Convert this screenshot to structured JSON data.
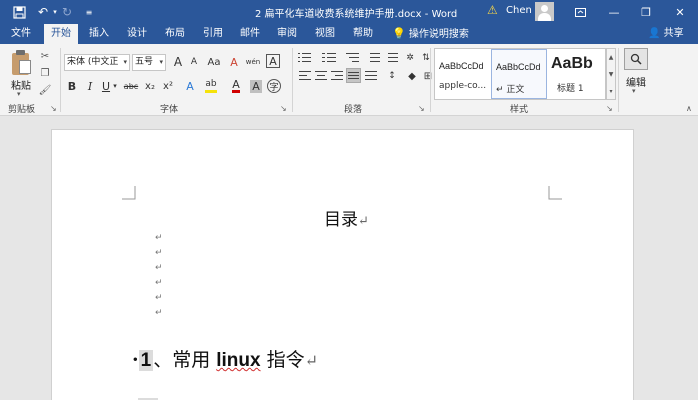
{
  "titlebar": {
    "title": "2 扁平化车道收费系统维护手册.docx  -  Word",
    "user": "Chen",
    "minimize": "—",
    "restore": "❐",
    "close": "✕"
  },
  "tabs": [
    "文件",
    "开始",
    "插入",
    "设计",
    "布局",
    "引用",
    "邮件",
    "审阅",
    "视图",
    "帮助"
  ],
  "active_tab": "开始",
  "tell_me": "操作说明搜索",
  "share": "共享",
  "clipboard": {
    "paste": "粘贴",
    "group": "剪贴板"
  },
  "font": {
    "name": "宋体 (中文正",
    "size": "五号",
    "group": "字体",
    "grow": "A",
    "shrink": "A",
    "case": "Aa",
    "clear": "A",
    "phonetic": "wén",
    "border": "A",
    "bold": "B",
    "italic": "I",
    "underline": "U",
    "strike": "abc",
    "sub": "x₂",
    "sup": "x²",
    "effects": "A",
    "highlight": "ab",
    "color": "A",
    "shade": "A",
    "circle": "字"
  },
  "paragraph": {
    "group": "段落"
  },
  "styles": {
    "group": "样式",
    "items": [
      {
        "sample": "AaBbCcDd",
        "name": "apple-co..."
      },
      {
        "sample": "AaBbCcDd",
        "name": "↵ 正文"
      },
      {
        "sample": "AaBb",
        "name": "标题 1"
      }
    ]
  },
  "editing": {
    "label": "编辑"
  },
  "document": {
    "toc_title": "目录",
    "para_mark": "↵",
    "heading_bullet": "·",
    "heading_num": "1",
    "heading_sep": "、常用 ",
    "heading_linux": "linux",
    "heading_rest": " 指令"
  },
  "colors": {
    "accent": "#2b579a",
    "ribbon": "#f3f3f3",
    "highlight_yellow": "#f5e20a",
    "font_red": "#d00000"
  }
}
